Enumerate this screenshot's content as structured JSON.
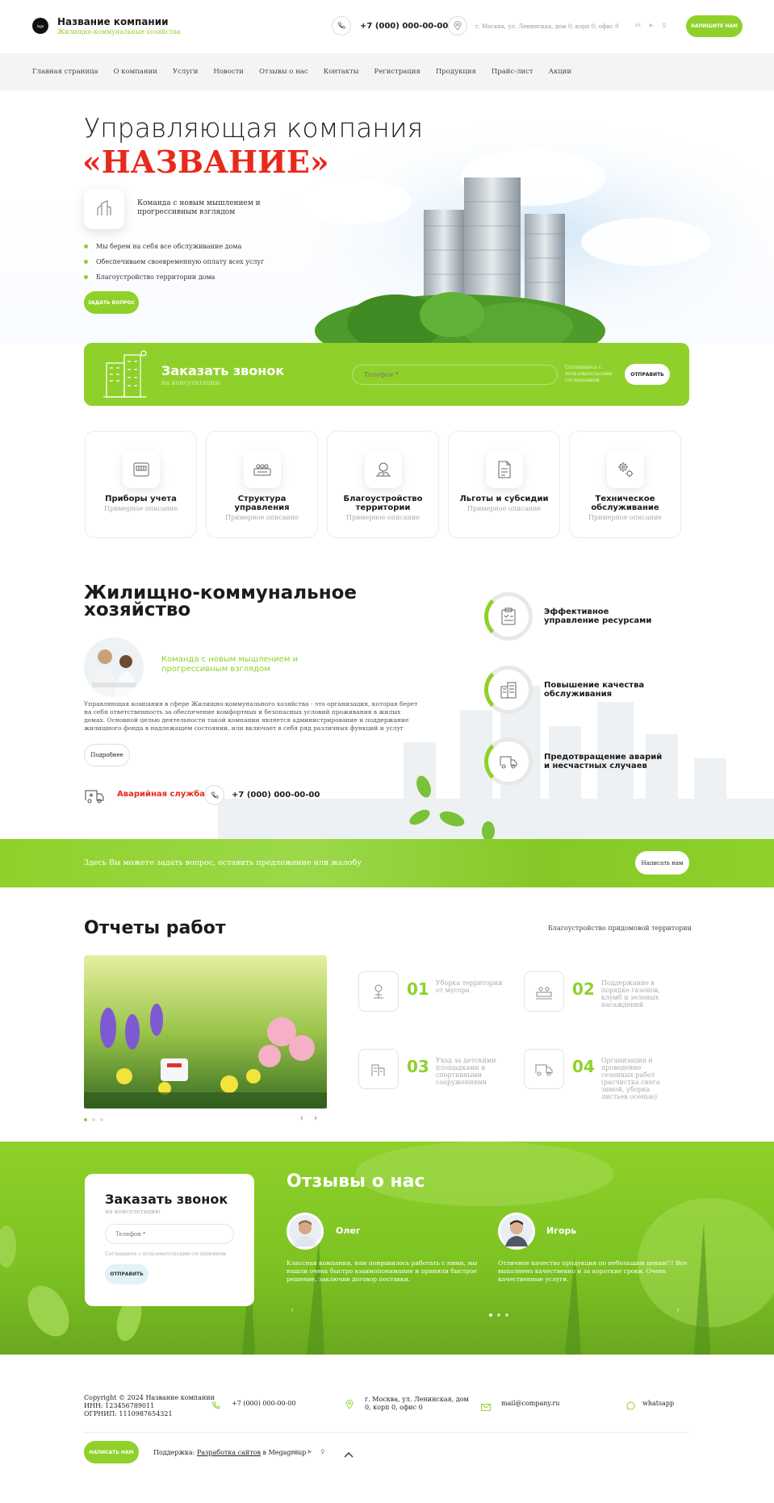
{
  "header": {
    "logo_text": "logo",
    "company": "Название компании",
    "tagline": "Жилищно-коммунальные хозяйства",
    "phone": "+7 (000) 000-00-00",
    "address": "г. Москва, ул. Ленинская, дом 0, корп 0, офис 0",
    "write_btn": "НАПИШИТЕ НАМ"
  },
  "nav": [
    "Главная страница",
    "О компании",
    "Услуги",
    "Новости",
    "Отзывы о нас",
    "Контакты",
    "Регистрация",
    "Продукция",
    "Прайс-лист",
    "Акции"
  ],
  "hero": {
    "title1": "Управляющая компания",
    "title2": "«НАЗВАНИЕ»",
    "team_text": "Команда с новым мышлением и прогрессивным взглядом",
    "bullets": [
      "Мы берем на себя все обслуживание дома",
      "Обеспечиваем своевременную оплату всех услуг",
      "Благоустройство территории дома"
    ],
    "ask_btn": "ЗАДАТЬ ВОПРОС"
  },
  "callback": {
    "title": "Заказать звонок",
    "subtitle": "на консультацию",
    "phone_placeholder": "Телефон *",
    "consent": "Соглашаюсь с пользовательским соглашением",
    "send": "ОТПРАВИТЬ"
  },
  "cards": [
    {
      "title": "Приборы учета",
      "desc": "Примерное описание",
      "icon": "meter-icon"
    },
    {
      "title": "Структура управления",
      "desc": "Примерное описание",
      "icon": "structure-icon"
    },
    {
      "title": "Благоустройство территории",
      "desc": "Примерное описание",
      "icon": "landscape-icon"
    },
    {
      "title": "Льготы и субсидии",
      "desc": "Примерное описание",
      "icon": "document-icon"
    },
    {
      "title": "Техническое обслуживание",
      "desc": "Примерное описание",
      "icon": "gears-icon"
    }
  ],
  "about": {
    "title": "Жилищно-коммунальное хозяйство",
    "team_text": "Команда с новым мышлением и прогрессивным взглядом",
    "paragraph": "Управляющая компания в сфере Жилищно-коммунального хозяйства - это организация, которая берет на себя ответственность за обеспечение комфортных и безопасных условий проживания в жилых домах. Основной целью деятельности такой компании является администрирование и поддержание жилищного фонда в надлежащем состоянии, или включает в себя ряд различных функций и услуг",
    "more": "Подробнее",
    "emergency": "Аварийная служба",
    "phone": "+7 (000) 000-00-00"
  },
  "features": [
    "Эффективное управление ресурсами",
    "Повышение качества обслуживания",
    "Предотвращение аварий и несчастных случаев"
  ],
  "question_banner": {
    "text": "Здесь Вы можете задать вопрос, оставить предложение или жалобу",
    "btn": "Написать нам"
  },
  "reports": {
    "title": "Отчеты работ",
    "category": "Благоустройство придомовой территории",
    "items": [
      {
        "n": "01",
        "t": "Уборка территории от мусора"
      },
      {
        "n": "02",
        "t": "Поддержание в порядке газонов, клумб и зеленых насаждений"
      },
      {
        "n": "03",
        "t": "Уход за детскими площадками и спортивными сооружениями"
      },
      {
        "n": "04",
        "t": "Организация и проведение сезонных работ (расчистка снега зимой, уборка листьев осенью)"
      }
    ]
  },
  "reviews": {
    "title": "Отзывы о нас",
    "items": [
      {
        "name": "Олег",
        "text": "Классная компания, нам понравилось работать с ними, мы нашли очень быстро взаимопонимание и приняли быстрое решение, заключив договор поставки."
      },
      {
        "name": "Игорь",
        "text": "Отличное качество продукции по небольшим ценам!!! Все выполнено качественно и за короткие сроки. Очень качественные услуги."
      }
    ]
  },
  "callback2": {
    "title": "Заказать звонок",
    "subtitle": "на консультацию",
    "phone_placeholder": "Телефон *",
    "consent": "Соглашаюсь с пользовательским соглашением",
    "send": "ОТПРАВИТЬ"
  },
  "footer": {
    "copyright": "Copyright © 2024 Название компании",
    "inn": "ИНН: 123456789011",
    "ogrnip": "ОГРНИП: 1110987654321",
    "phone": "+7 (000) 000-00-00",
    "address": "г. Москва, ул. Ленинская, дом 0, корп 0, офис 0",
    "email": "mail@company.ru",
    "whatsapp": "whatsapp",
    "write_btn": "НАПИСАТЬ НАМ",
    "support_prefix": "Поддержка:",
    "support_link": "Разработка сайтов",
    "support_suffix": "в Megagroup"
  },
  "colors": {
    "accent": "#8fd12a",
    "red": "#e8291c"
  }
}
